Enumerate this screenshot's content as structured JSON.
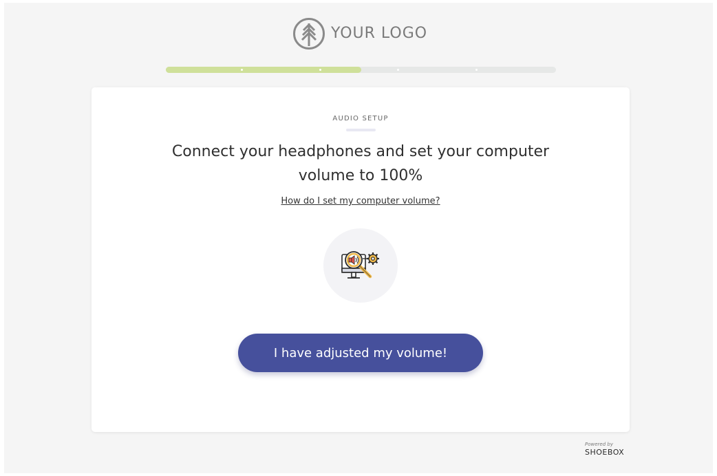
{
  "logo": {
    "text": "YOUR LOGO",
    "icon": "tree-circle-icon"
  },
  "progress": {
    "filled_fraction": 0.5,
    "fill_color": "#cfe09a",
    "track_color": "#e6e8e7"
  },
  "card": {
    "kicker": "AUDIO SETUP",
    "heading": "Connect your headphones and set your computer volume to 100%",
    "help_link": "How do I set my computer volume?",
    "illustration": "computer-volume-settings-icon",
    "cta_label": "I have adjusted my volume!",
    "cta_color": "#46509c"
  },
  "footer": {
    "powered_by": "Powered by",
    "brand": "SHOEBOX"
  }
}
